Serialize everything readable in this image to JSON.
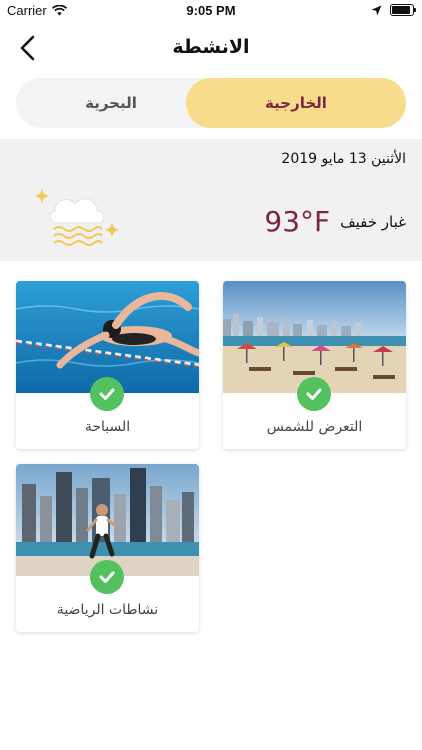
{
  "status": {
    "carrier": "Carrier",
    "time": "9:05 PM"
  },
  "nav": {
    "title": "الانشطة"
  },
  "tabs": [
    {
      "label": "الخارجية",
      "selected": true
    },
    {
      "label": "البحرية",
      "selected": false
    }
  ],
  "weather": {
    "date": "الأثنين 13 مايو 2019",
    "condition": "غبار خفيف",
    "temperature": "93°F"
  },
  "activities": [
    {
      "label": "التعرض للشمس",
      "checked": true
    },
    {
      "label": "السباحة",
      "checked": true
    },
    {
      "label": "نشاطات الرياضية",
      "checked": true
    }
  ],
  "colors": {
    "accent": "#7c2643",
    "tab_highlight": "#f8dc8c",
    "check": "#52c15e",
    "weather_bg": "#f1f1f1"
  }
}
